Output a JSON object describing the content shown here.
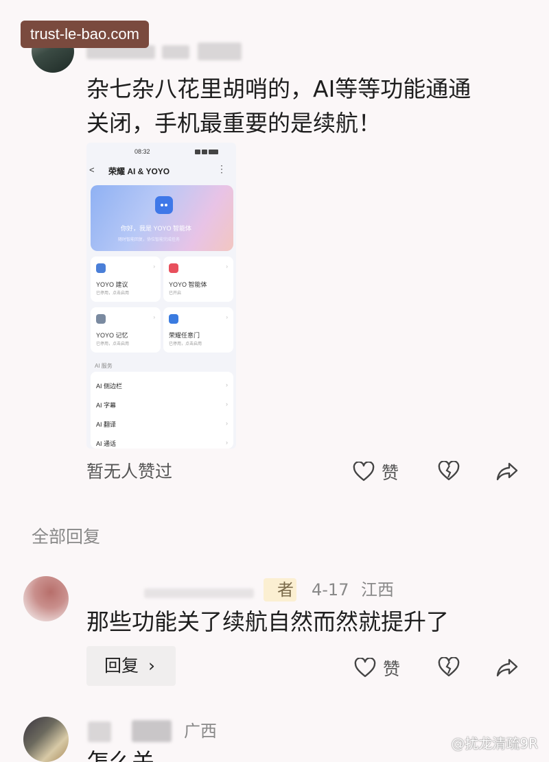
{
  "watermark_top": "trust-le-bao.com",
  "post": {
    "text_line1": "杂七杂八花里胡哨的，AI等等功能通通",
    "text_line2": "关闭，手机最重要的是续航！",
    "likes_text": "暂无人赞过",
    "like_label": "赞"
  },
  "phone": {
    "time": "08:32",
    "title": "荣耀 AI & YOYO",
    "hero_line1": "你好，我是 YOYO 智能体",
    "hero_line2": "随时智能回复，协位智能完成任务",
    "cards": [
      {
        "label": "YOYO 建议",
        "sub": "已停用，点击启用",
        "color": "#4a7fd8"
      },
      {
        "label": "YOYO 智能体",
        "sub": "已开启",
        "color": "#e84f5c"
      },
      {
        "label": "YOYO 记忆",
        "sub": "已停用，点击启用",
        "color": "#7a8aa0"
      },
      {
        "label": "荣耀任意门",
        "sub": "已停用，点击启用",
        "color": "#3a7be0"
      }
    ],
    "section": "AI 服务",
    "list": [
      "AI 侧边栏",
      "AI 字幕",
      "AI 翻译",
      "AI 通话"
    ]
  },
  "replies_header": "全部回复",
  "reply1": {
    "author_tag": "者",
    "date": "4-17",
    "region": "江西",
    "text": "那些功能关了续航自然而然就提升了",
    "reply_button": "回复",
    "like_label": "赞"
  },
  "reply2": {
    "region": "广西",
    "text": "怎么关"
  },
  "watermark_bottom": "@扰龙清疏9R",
  "icons": [
    "heart-icon",
    "heart-broken-icon",
    "share-icon",
    "chevron-right-icon"
  ]
}
